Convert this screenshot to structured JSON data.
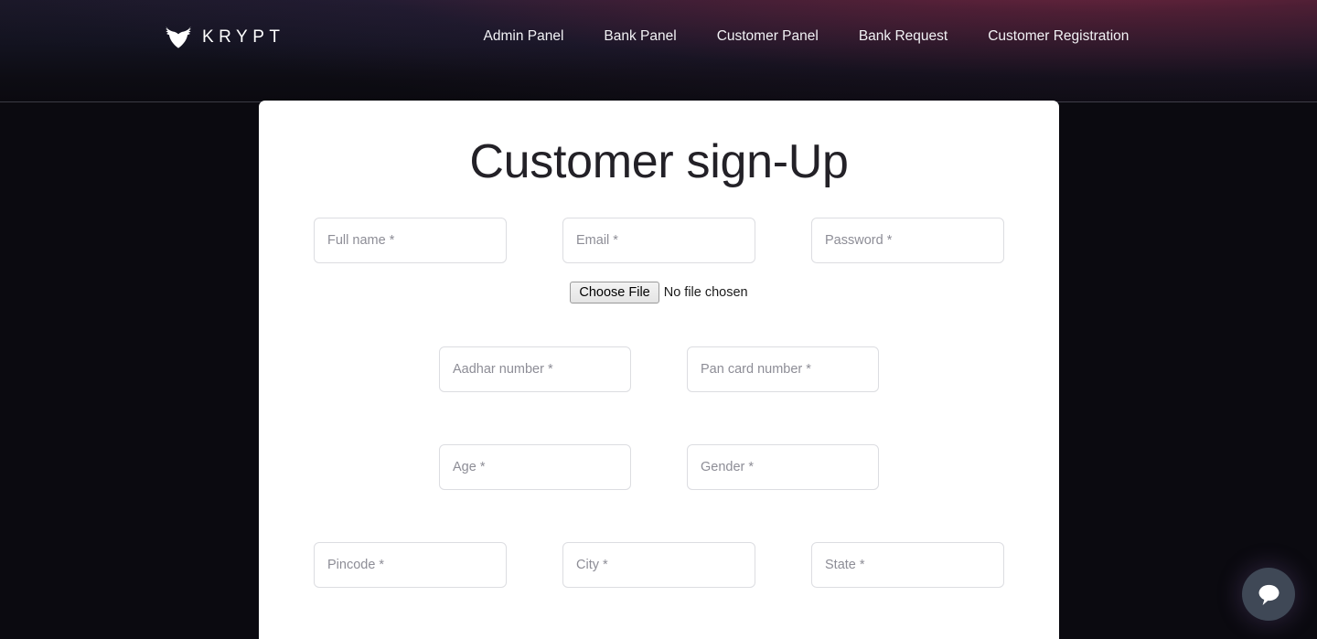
{
  "header": {
    "brand_name": "KRYPT",
    "brand_icon": "bat-mask-icon",
    "nav_links": [
      {
        "label": "Admin Panel"
      },
      {
        "label": "Bank Panel"
      },
      {
        "label": "Customer Panel"
      },
      {
        "label": "Bank Request"
      },
      {
        "label": "Customer Registration"
      }
    ]
  },
  "card": {
    "title": "Customer sign-Up",
    "fields": {
      "full_name": {
        "placeholder": "Full name *",
        "value": ""
      },
      "email": {
        "placeholder": "Email *",
        "value": ""
      },
      "password": {
        "placeholder": "Password *",
        "value": ""
      },
      "aadhar_number": {
        "placeholder": "Aadhar number *",
        "value": ""
      },
      "pan_card_number": {
        "placeholder": "Pan card number *",
        "value": ""
      },
      "age": {
        "placeholder": "Age *",
        "value": ""
      },
      "gender": {
        "placeholder": "Gender *",
        "value": ""
      },
      "pincode": {
        "placeholder": "Pincode *",
        "value": ""
      },
      "city": {
        "placeholder": "City *",
        "value": ""
      },
      "state": {
        "placeholder": "State *",
        "value": ""
      }
    },
    "file_upload": {
      "button_label": "Choose File",
      "status_text": "No file chosen"
    }
  },
  "chat_widget": {
    "icon": "chat-bubble-icon"
  },
  "colors": {
    "page_background": "#0b0a10",
    "card_background": "#ffffff",
    "title_text": "#232127",
    "input_border": "#dcdde1",
    "placeholder_text": "#8d8d96",
    "nav_text": "#f2f2f5",
    "glow_accent": "#b63454",
    "chat_button": "#3f4856"
  }
}
